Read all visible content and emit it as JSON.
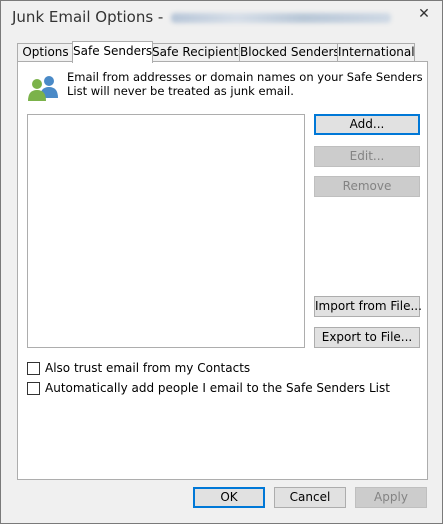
{
  "window": {
    "title": "Junk Email Options -",
    "close_glyph": "✕"
  },
  "tabs": [
    {
      "label": "Options"
    },
    {
      "label": "Safe Senders"
    },
    {
      "label": "Safe Recipients"
    },
    {
      "label": "Blocked Senders"
    },
    {
      "label": "International"
    }
  ],
  "safe_senders": {
    "description": "Email from addresses or domain names on your Safe Senders List will never be treated as junk email.",
    "icon": "contacts-icon",
    "buttons": {
      "add": "Add...",
      "edit": "Edit...",
      "remove": "Remove",
      "import": "Import from File...",
      "export": "Export to File..."
    },
    "checkboxes": [
      {
        "label": "Also trust email from my Contacts",
        "checked": false
      },
      {
        "label": "Automatically add people I email to the Safe Senders List",
        "checked": false
      }
    ]
  },
  "footer": {
    "ok": "OK",
    "cancel": "Cancel",
    "apply": "Apply"
  }
}
